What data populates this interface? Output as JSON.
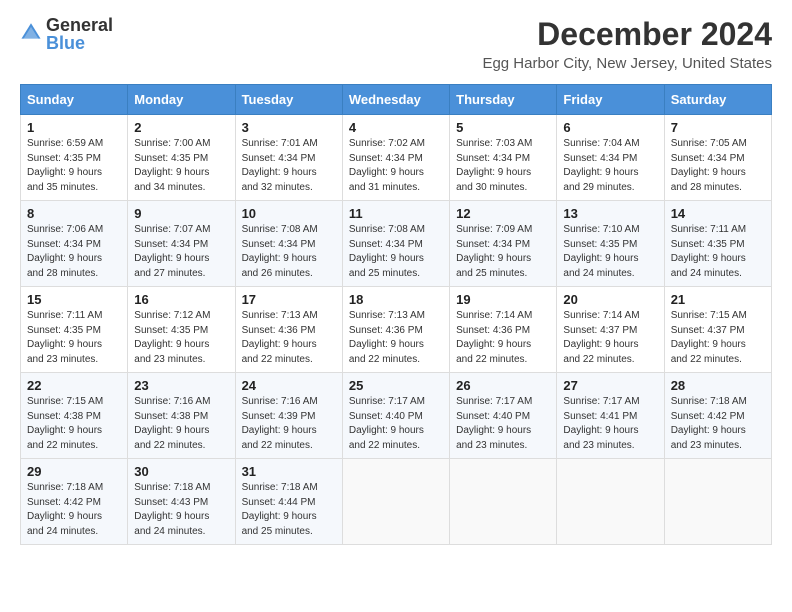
{
  "header": {
    "logo_general": "General",
    "logo_blue": "Blue",
    "month_title": "December 2024",
    "location": "Egg Harbor City, New Jersey, United States"
  },
  "weekdays": [
    "Sunday",
    "Monday",
    "Tuesday",
    "Wednesday",
    "Thursday",
    "Friday",
    "Saturday"
  ],
  "weeks": [
    [
      {
        "day": "1",
        "sunrise": "6:59 AM",
        "sunset": "4:35 PM",
        "daylight": "9 hours and 35 minutes."
      },
      {
        "day": "2",
        "sunrise": "7:00 AM",
        "sunset": "4:35 PM",
        "daylight": "9 hours and 34 minutes."
      },
      {
        "day": "3",
        "sunrise": "7:01 AM",
        "sunset": "4:34 PM",
        "daylight": "9 hours and 32 minutes."
      },
      {
        "day": "4",
        "sunrise": "7:02 AM",
        "sunset": "4:34 PM",
        "daylight": "9 hours and 31 minutes."
      },
      {
        "day": "5",
        "sunrise": "7:03 AM",
        "sunset": "4:34 PM",
        "daylight": "9 hours and 30 minutes."
      },
      {
        "day": "6",
        "sunrise": "7:04 AM",
        "sunset": "4:34 PM",
        "daylight": "9 hours and 29 minutes."
      },
      {
        "day": "7",
        "sunrise": "7:05 AM",
        "sunset": "4:34 PM",
        "daylight": "9 hours and 28 minutes."
      }
    ],
    [
      {
        "day": "8",
        "sunrise": "7:06 AM",
        "sunset": "4:34 PM",
        "daylight": "9 hours and 28 minutes."
      },
      {
        "day": "9",
        "sunrise": "7:07 AM",
        "sunset": "4:34 PM",
        "daylight": "9 hours and 27 minutes."
      },
      {
        "day": "10",
        "sunrise": "7:08 AM",
        "sunset": "4:34 PM",
        "daylight": "9 hours and 26 minutes."
      },
      {
        "day": "11",
        "sunrise": "7:08 AM",
        "sunset": "4:34 PM",
        "daylight": "9 hours and 25 minutes."
      },
      {
        "day": "12",
        "sunrise": "7:09 AM",
        "sunset": "4:34 PM",
        "daylight": "9 hours and 25 minutes."
      },
      {
        "day": "13",
        "sunrise": "7:10 AM",
        "sunset": "4:35 PM",
        "daylight": "9 hours and 24 minutes."
      },
      {
        "day": "14",
        "sunrise": "7:11 AM",
        "sunset": "4:35 PM",
        "daylight": "9 hours and 24 minutes."
      }
    ],
    [
      {
        "day": "15",
        "sunrise": "7:11 AM",
        "sunset": "4:35 PM",
        "daylight": "9 hours and 23 minutes."
      },
      {
        "day": "16",
        "sunrise": "7:12 AM",
        "sunset": "4:35 PM",
        "daylight": "9 hours and 23 minutes."
      },
      {
        "day": "17",
        "sunrise": "7:13 AM",
        "sunset": "4:36 PM",
        "daylight": "9 hours and 22 minutes."
      },
      {
        "day": "18",
        "sunrise": "7:13 AM",
        "sunset": "4:36 PM",
        "daylight": "9 hours and 22 minutes."
      },
      {
        "day": "19",
        "sunrise": "7:14 AM",
        "sunset": "4:36 PM",
        "daylight": "9 hours and 22 minutes."
      },
      {
        "day": "20",
        "sunrise": "7:14 AM",
        "sunset": "4:37 PM",
        "daylight": "9 hours and 22 minutes."
      },
      {
        "day": "21",
        "sunrise": "7:15 AM",
        "sunset": "4:37 PM",
        "daylight": "9 hours and 22 minutes."
      }
    ],
    [
      {
        "day": "22",
        "sunrise": "7:15 AM",
        "sunset": "4:38 PM",
        "daylight": "9 hours and 22 minutes."
      },
      {
        "day": "23",
        "sunrise": "7:16 AM",
        "sunset": "4:38 PM",
        "daylight": "9 hours and 22 minutes."
      },
      {
        "day": "24",
        "sunrise": "7:16 AM",
        "sunset": "4:39 PM",
        "daylight": "9 hours and 22 minutes."
      },
      {
        "day": "25",
        "sunrise": "7:17 AM",
        "sunset": "4:40 PM",
        "daylight": "9 hours and 22 minutes."
      },
      {
        "day": "26",
        "sunrise": "7:17 AM",
        "sunset": "4:40 PM",
        "daylight": "9 hours and 23 minutes."
      },
      {
        "day": "27",
        "sunrise": "7:17 AM",
        "sunset": "4:41 PM",
        "daylight": "9 hours and 23 minutes."
      },
      {
        "day": "28",
        "sunrise": "7:18 AM",
        "sunset": "4:42 PM",
        "daylight": "9 hours and 23 minutes."
      }
    ],
    [
      {
        "day": "29",
        "sunrise": "7:18 AM",
        "sunset": "4:42 PM",
        "daylight": "9 hours and 24 minutes."
      },
      {
        "day": "30",
        "sunrise": "7:18 AM",
        "sunset": "4:43 PM",
        "daylight": "9 hours and 24 minutes."
      },
      {
        "day": "31",
        "sunrise": "7:18 AM",
        "sunset": "4:44 PM",
        "daylight": "9 hours and 25 minutes."
      },
      null,
      null,
      null,
      null
    ]
  ],
  "labels": {
    "sunrise_prefix": "Sunrise: ",
    "sunset_prefix": "Sunset: ",
    "daylight_prefix": "Daylight: "
  }
}
